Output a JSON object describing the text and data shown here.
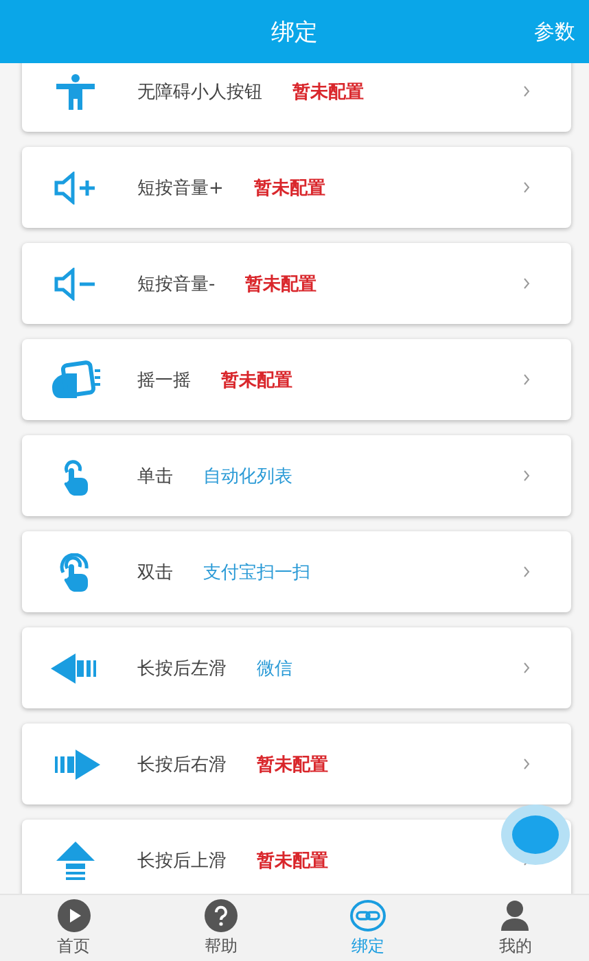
{
  "header": {
    "title": "绑定",
    "action": "参数"
  },
  "items": [
    {
      "label": "无障碍小人按钮",
      "value": "暂未配置",
      "configured": false
    },
    {
      "label": "短按音量+",
      "value": "暂未配置",
      "configured": false
    },
    {
      "label": "短按音量-",
      "value": "暂未配置",
      "configured": false
    },
    {
      "label": "摇一摇",
      "value": "暂未配置",
      "configured": false
    },
    {
      "label": "单击",
      "value": "自动化列表",
      "configured": true
    },
    {
      "label": "双击",
      "value": "支付宝扫一扫",
      "configured": true
    },
    {
      "label": "长按后左滑",
      "value": "微信",
      "configured": true
    },
    {
      "label": "长按后右滑",
      "value": "暂未配置",
      "configured": false
    },
    {
      "label": "长按后上滑",
      "value": "暂未配置",
      "configured": false
    }
  ],
  "tabs": [
    {
      "label": "首页",
      "selected": false
    },
    {
      "label": "帮助",
      "selected": false
    },
    {
      "label": "绑定",
      "selected": true
    },
    {
      "label": "我的",
      "selected": false
    }
  ]
}
